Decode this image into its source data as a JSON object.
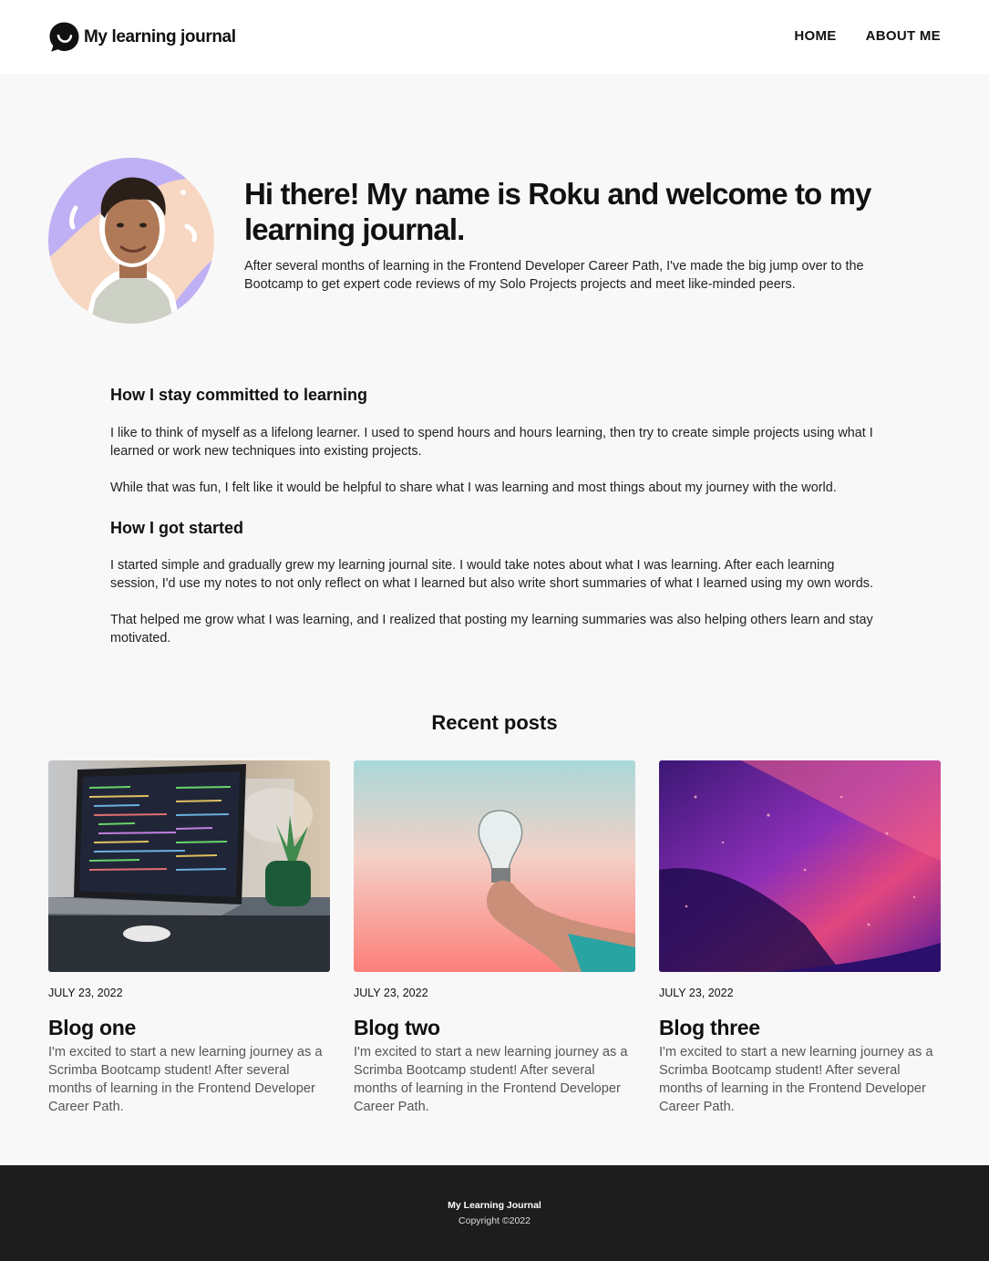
{
  "header": {
    "brand_icon": "chat-smile-icon",
    "brand_title": "My learning journal",
    "nav": [
      {
        "label": "HOME"
      },
      {
        "label": "ABOUT ME"
      }
    ]
  },
  "hero": {
    "title": "Hi there! My name is Roku and welcome to my learning journal.",
    "text": "After several months of learning in the Frontend Developer Career Path, I've made the big jump over to the Bootcamp to get expert code reviews of my Solo Projects projects and meet like-minded peers."
  },
  "article": {
    "heading1": "How I stay committed to learning",
    "p1": "I like to think of myself as a lifelong learner. I used to spend hours and hours learning, then try to create simple projects using what I learned or work new techniques into existing projects.",
    "p2": "While that was fun, I felt like it would be helpful to share what I was learning and most things about my journey with the world.",
    "heading2": "How I got started",
    "p3": "I started simple and gradually grew my learning journal site. I would take notes about what I was learning. After each learning session, I'd use my notes to not only reflect on what I learned but also write short summaries of what I learned using my own words.",
    "p4": "That helped me grow what I was learning, and I realized that posting my learning summaries was also helping others learn and stay motivated."
  },
  "recent": {
    "title": "Recent posts",
    "posts": [
      {
        "date": "JULY 23, 2022",
        "title": "Blog one",
        "text": "I'm excited to start a new learning journey as a Scrimba Bootcamp student! After several months of learning in the Frontend Developer Career Path.",
        "image": "laptop-code-photo"
      },
      {
        "date": "JULY 23, 2022",
        "title": "Blog two",
        "text": "I'm excited to start a new learning journey as a Scrimba Bootcamp student! After several months of learning in the Frontend Developer Career Path.",
        "image": "lightbulb-hand-photo"
      },
      {
        "date": "JULY 23, 2022",
        "title": "Blog three",
        "text": "I'm excited to start a new learning journey as a Scrimba Bootcamp student! After several months of learning in the Frontend Developer Career Path.",
        "image": "purple-abstract-photo"
      }
    ]
  },
  "footer": {
    "title": "My Learning Journal",
    "copyright": "Copyright ©2022"
  },
  "colors": {
    "header_bg": "#ffffff",
    "page_bg": "#f8f8f8",
    "footer_bg": "#1d1d1d",
    "text": "#111111",
    "muted_text": "#555555"
  }
}
